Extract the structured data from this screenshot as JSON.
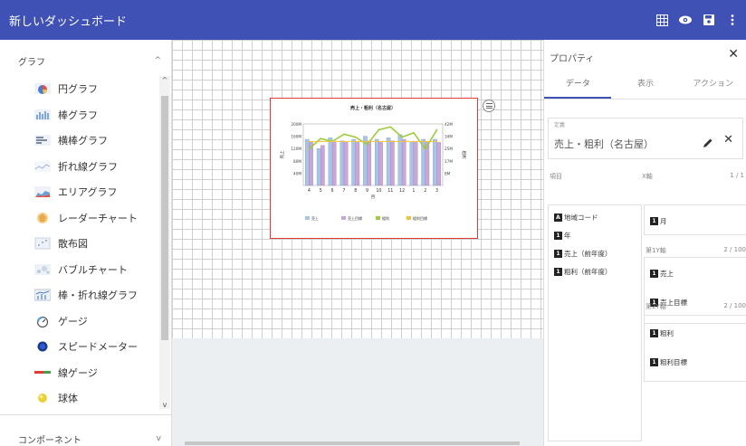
{
  "header": {
    "title": "新しいダッシュボード"
  },
  "left_panel": {
    "section_graph": "グラフ",
    "section_components": "コンポーネント",
    "items": [
      {
        "label": "円グラフ",
        "icon": "pie-chart-icon"
      },
      {
        "label": "棒グラフ",
        "icon": "bar-chart-icon"
      },
      {
        "label": "横棒グラフ",
        "icon": "horizontal-bar-chart-icon"
      },
      {
        "label": "折れ線グラフ",
        "icon": "line-chart-icon"
      },
      {
        "label": "エリアグラフ",
        "icon": "area-chart-icon"
      },
      {
        "label": "レーダーチャート",
        "icon": "radar-chart-icon"
      },
      {
        "label": "散布図",
        "icon": "scatter-chart-icon"
      },
      {
        "label": "バブルチャート",
        "icon": "bubble-chart-icon"
      },
      {
        "label": "棒・折れ線グラフ",
        "icon": "combo-chart-icon"
      },
      {
        "label": "ゲージ",
        "icon": "gauge-icon"
      },
      {
        "label": "スピードメーター",
        "icon": "speedometer-icon"
      },
      {
        "label": "線ゲージ",
        "icon": "line-gauge-icon"
      },
      {
        "label": "球体",
        "icon": "sphere-icon"
      }
    ]
  },
  "properties": {
    "title": "プロパティ",
    "tabs": [
      "データ",
      "表示",
      "アクション"
    ],
    "definition_label": "定義",
    "definition_value": "売上・粗利（名古屋）",
    "items_label": "項目",
    "fields": [
      {
        "tag": "A",
        "label": "地域コード"
      },
      {
        "tag": "1",
        "label": "年"
      },
      {
        "tag": "1",
        "label": "売上（前年度）"
      },
      {
        "tag": "1",
        "label": "粗利（前年度）"
      }
    ],
    "x_axis": {
      "label": "X軸",
      "count": "1 / 1",
      "items": [
        "月"
      ]
    },
    "y1_axis": {
      "label": "第1Y軸",
      "count": "2 / 100",
      "items": [
        "売上",
        "売上目標"
      ]
    },
    "y2_axis": {
      "label": "第2Y軸",
      "count": "2 / 100",
      "items": [
        "粗利",
        "粗利目標"
      ]
    }
  },
  "chart_data": {
    "type": "bar",
    "title": "売上・粗利（名古屋）",
    "xlabel": "月",
    "ylabel": "売上",
    "y2label": "粗利",
    "categories": [
      "4",
      "5",
      "6",
      "7",
      "8",
      "9",
      "10",
      "11",
      "12",
      "1",
      "2",
      "3"
    ],
    "ylim": [
      0,
      200
    ],
    "y2lim": [
      0,
      42
    ],
    "y_ticks": [
      "200M",
      "160M",
      "120M",
      "80M",
      "40M"
    ],
    "y2_ticks": [
      "42M",
      "34M",
      "25M",
      "17M",
      "8M"
    ],
    "series": [
      {
        "name": "売上",
        "type": "bar",
        "axis": "y1",
        "values": [
          150,
          120,
          155,
          145,
          150,
          160,
          150,
          155,
          165,
          140,
          150,
          150
        ]
      },
      {
        "name": "売上目標",
        "type": "bar",
        "axis": "y1",
        "values": [
          140,
          130,
          140,
          140,
          140,
          145,
          140,
          145,
          150,
          140,
          140,
          140
        ]
      },
      {
        "name": "粗利",
        "type": "line",
        "axis": "y2",
        "values": [
          25,
          32,
          30,
          35,
          33,
          28,
          38,
          40,
          33,
          36,
          25,
          38
        ]
      },
      {
        "name": "粗利目標",
        "type": "line",
        "axis": "y2",
        "values": [
          30,
          30,
          30,
          30,
          30,
          30,
          30,
          30,
          30,
          30,
          30,
          30
        ]
      }
    ],
    "colors": {
      "売上": "#a9c4e6",
      "売上目標": "#c9a6d8",
      "粗利": "#9ccc3c",
      "粗利目標": "#f3c23a"
    },
    "legend_position": "bottom"
  }
}
